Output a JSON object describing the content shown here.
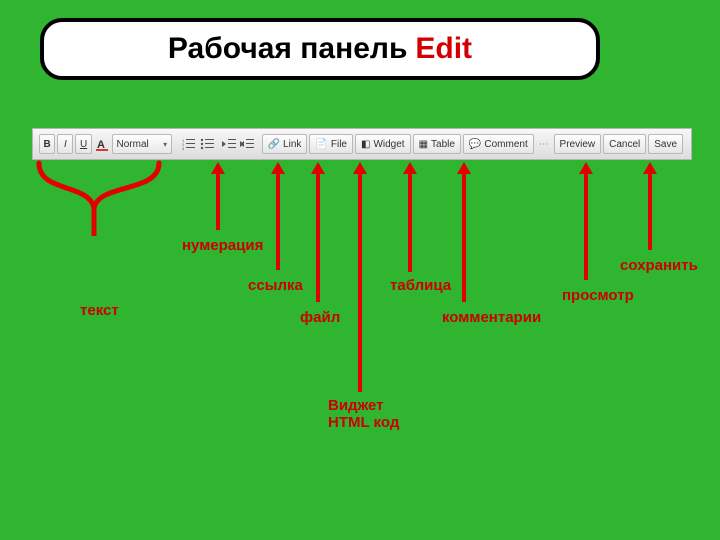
{
  "title": {
    "part1": "Рабочая панель",
    "part2": "Edit"
  },
  "toolbar": {
    "bold": "B",
    "italic": "I",
    "underline": "U",
    "format_select": "Normal",
    "link": "Link",
    "file": "File",
    "widget": "Widget",
    "table": "Table",
    "comment": "Comment",
    "preview": "Preview",
    "cancel": "Cancel",
    "save": "Save"
  },
  "labels": {
    "text": "текст",
    "numbering": "нумерация",
    "link": "ссылка",
    "file": "файл",
    "widget_html": "Виджет HTML код",
    "table": "таблица",
    "comments": "комментарии",
    "preview": "просмотр",
    "save": "сохранить"
  }
}
